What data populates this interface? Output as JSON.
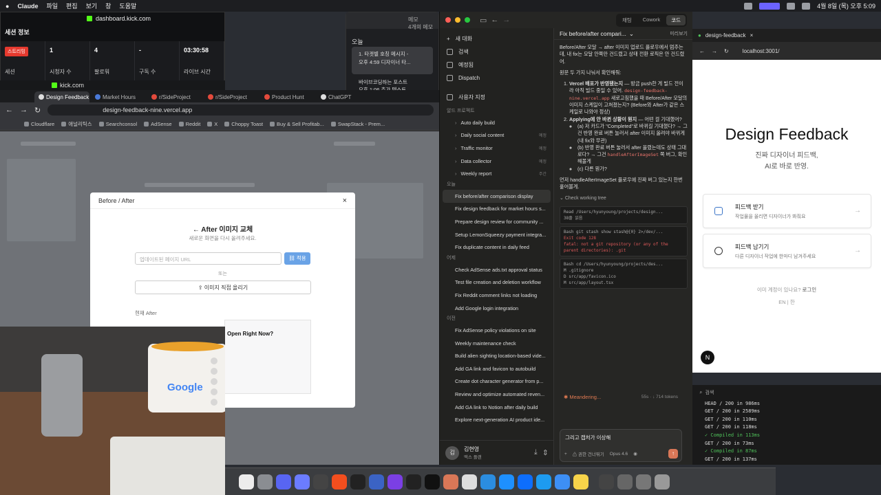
{
  "menubar": {
    "app": "Claude",
    "items": [
      "파일",
      "편집",
      "보기",
      "창",
      "도움말"
    ],
    "datetime": "4월 8일 (목) 오후 5:09"
  },
  "dash_window": {
    "url": "dashboard.kick.com",
    "title": "세션 정보",
    "cells": [
      {
        "label": "세션",
        "value": "스트리밍"
      },
      {
        "label": "시청자 수",
        "value": "1"
      },
      {
        "label": "팔로워",
        "value": "4"
      },
      {
        "label": "구독 수",
        "value": "-"
      },
      {
        "label": "라이브 시간",
        "value": "03:30:58"
      }
    ]
  },
  "kick_bar": {
    "url": "kick.com"
  },
  "memo_window": {
    "header": "메모",
    "subheader": "4개의 메모",
    "today": "오늘",
    "note1_title": "1. 타겟별 호칭 메시지 -",
    "note1_meta": "오후 4:59  디자이너 타...",
    "note2_title": "바이브코딩하는 포스트",
    "note2_meta": "오후 1:06  추가 텍스트..."
  },
  "chrome": {
    "tabs": [
      {
        "label": "Design Feedback",
        "active": true
      },
      {
        "label": "Market Hours"
      },
      {
        "label": "r/SideProject"
      },
      {
        "label": "r/SideProject"
      },
      {
        "label": "Product Hunt"
      },
      {
        "label": "ChatGPT"
      }
    ],
    "url": "design-feedback-nine.vercel.app",
    "bookmarks": [
      "Cloudflare",
      "애널리틱스",
      "Searchconsol",
      "AdSense",
      "Reddit",
      "X",
      "Choppy Toast",
      "Buy & Sell Profitab...",
      "SwapStack - Prem..."
    ]
  },
  "modal": {
    "header": "Before / After",
    "title": "After 이미지 교체",
    "subtitle": "새로운 화면을 다시 올려주세요.",
    "url_placeholder": "업데이트된 페이지 URL",
    "apply": "적용",
    "or": "또는",
    "upload": "이미지 직접 올리기",
    "current_label": "현재 After",
    "preview_title": "Open Right Now?"
  },
  "webcam": {
    "mug_text": "Google"
  },
  "claude": {
    "segments": [
      "채팅",
      "Cowork",
      "코드"
    ],
    "nav": [
      {
        "label": "새 대화",
        "icon": "plus-icon"
      },
      {
        "label": "검색",
        "icon": "search-icon"
      },
      {
        "label": "예정됨",
        "icon": "clock-icon"
      },
      {
        "label": "Dispatch",
        "icon": "dispatch-icon"
      },
      {
        "label": "사용자 지정",
        "icon": "customize-icon"
      }
    ],
    "project_section": "알드 프로젝트",
    "projects": [
      {
        "label": "Auto daily build",
        "time": ""
      },
      {
        "label": "Daily social content",
        "time": "예정"
      },
      {
        "label": "Traffic monitor",
        "time": "예정"
      },
      {
        "label": "Data collector",
        "time": "예정"
      },
      {
        "label": "Weekly report",
        "time": "주간"
      }
    ],
    "today_label": "오늘",
    "today": [
      "Fix before/after comparison display",
      "Fix design feedback for market hours s...",
      "Prepare design review for community ...",
      "Setup LemonSqueezy payment integra...",
      "Fix duplicate content in daily feed"
    ],
    "yesterday_label": "어제",
    "yesterday": [
      "Check AdSense ads.txt approval status",
      "Test file creation and deletion workflow",
      "Fix Reddit comment links not loading",
      "Add Google login integration"
    ],
    "older_label": "이전",
    "older": [
      "Fix AdSense policy violations on site",
      "Weekly maintenance check",
      "Build alien sighting location-based vide...",
      "Add GA link and favicon to autobuild",
      "Create dot character generator from p...",
      "Review and optimize automated reven...",
      "Add GA link to Notion after daily build",
      "Explore next-generation AI product ide..."
    ],
    "user": {
      "initial": "김",
      "name": "김현영",
      "plan": "맥스 플랜"
    },
    "chat_title": "Fix before/after compari...",
    "branch": "미리보기",
    "p1": "Before/After 모달 → after 이미지 업로드 플로우에서 멈추는데, 내 fix는 모달 안쪽만 건드렸고 상태 전환 로직은 안 건드렸어.",
    "p2": "원문 두 가지 나눠서 확인해줘:",
    "o1_title": "Vercel 배포가 반영됐는지",
    "o1_text": " — 방금 push한 게 빌드 전이라 아직 빌드 중일 수 있어.",
    "o1_code": "design-feedback-nine.vercel.app",
    "o1_text2": " 새로고침했을 때 Before/After 모달의 이미지 스케일이 고쳐졌는지? (Before와 After가 같은 스케일로 나와야 정상)",
    "o2_title": "Applying에 안 바뀐 상황이 뭔지",
    "o2_text": " — 어떤 걸 기대했어?",
    "b1": "(a) 저 카드가 \"Completed\"로 바뀌길 기대했다? → 그건 반영 완료 버튼 눌러서 after 이미지 올려야 바뀌게 (내 fix와 무관)",
    "b2a": "(b) 반영 완료 버튼 눌러서 after 올렸는데도 상태 그대로다? → 그건 ",
    "b2code": "handleAfterImageSet",
    "b2b": " 쪽 버그, 확인해볼게",
    "b3": "(c) 다른 뭔가?",
    "p3": "먼저 handleAfterImageSet 플로우에 진짜 버그 있는지 한번 훑어볼게.",
    "tree": "Check working tree",
    "tool1": "Read  /Users/hyunyoung/projects/design...",
    "tool1b": "38줄 읽음",
    "tool2": "Bash  git stash show stash@{0} 2>/dev/...",
    "tool2e1": "Exit code 128",
    "tool2e2": "fatal: not a git repository (or any of the parent directories): .git",
    "tool3": "Bash  cd /Users/hyunyoung/projects/des...",
    "tool3l1": "M .gitignore",
    "tool3l2": "D src/app/favicon.ico",
    "tool3l3": "M src/app/layout.tsx",
    "status": "✱ Meandering...",
    "tokens": "55s · ↓ 714 tokens",
    "composer_text": "그리고 캡처가 이상해",
    "mode": "권한 건너뛰기",
    "model": "Opus 4.6"
  },
  "preview": {
    "tab": "design-feedback",
    "url": "localhost:3001/",
    "title": "Design Feedback",
    "sub1": "진짜 디자이너 피드백,",
    "sub2": "AI로 바로 반영.",
    "card1_title": "피드백 받기",
    "card1_desc": "작업물을 올리면 디자이너가 봐줘요",
    "card2_title": "피드백 남기기",
    "card2_desc": "다른 디자이너 작업에 한마디 남겨주세요",
    "login_q": "이미 계정이 있나요?",
    "login_link": "로그인",
    "lang": "EN | 한",
    "badge": "N"
  },
  "terminal": {
    "search": "검색",
    "lines": [
      {
        "m": "HEAD / 200 in 986ms",
        "ok": false
      },
      {
        "m": "GET / 200 in 2589ms",
        "ok": false
      },
      {
        "m": "GET / 200 in 110ms",
        "ok": false
      },
      {
        "m": "GET / 200 in 118ms",
        "ok": false
      },
      {
        "m": "✓ Compiled in 113ms",
        "ok": true
      },
      {
        "m": "GET / 200 in 73ms",
        "ok": false
      },
      {
        "m": "✓ Compiled in 87ms",
        "ok": true
      },
      {
        "m": "GET / 200 in 137ms",
        "ok": false
      }
    ]
  },
  "colors": {
    "accent": "#d97757",
    "kick": "#53fc18",
    "apply": "#6aa3e6"
  }
}
